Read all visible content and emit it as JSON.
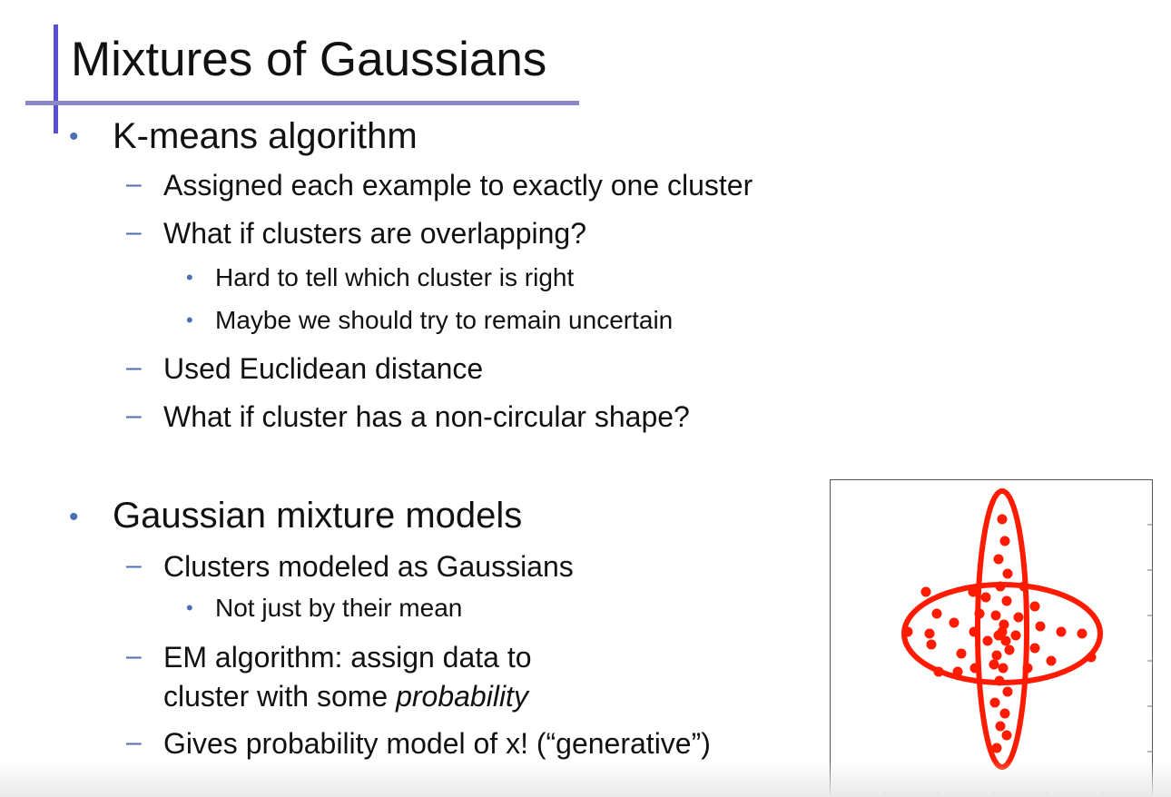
{
  "slide": {
    "title": "Mixtures of Gaussians",
    "sections": [
      {
        "heading": "K-means algorithm",
        "items": [
          {
            "text": "Assigned each example to exactly one cluster"
          },
          {
            "text": "What if clusters are overlapping?",
            "subitems": [
              "Hard to tell which cluster is right",
              "Maybe we should try to remain uncertain"
            ]
          },
          {
            "text": "Used Euclidean distance"
          },
          {
            "text": "What if cluster has a non-circular shape?"
          }
        ]
      },
      {
        "heading": "Gaussian mixture models",
        "items": [
          {
            "text": "Clusters modeled as Gaussians",
            "subitems": [
              "Not just by their mean"
            ]
          },
          {
            "text_line1": "EM algorithm: assign data to",
            "text_line2_pre": "cluster with some ",
            "text_line2_em": "probability"
          },
          {
            "text": "Gives probability model of x!  (“generative”)"
          }
        ]
      }
    ],
    "bullet_symbols": {
      "level1": "•",
      "level2": "–",
      "level3": "•"
    }
  },
  "figure": {
    "color": "#ff1a00",
    "frame_color": "#555555"
  }
}
